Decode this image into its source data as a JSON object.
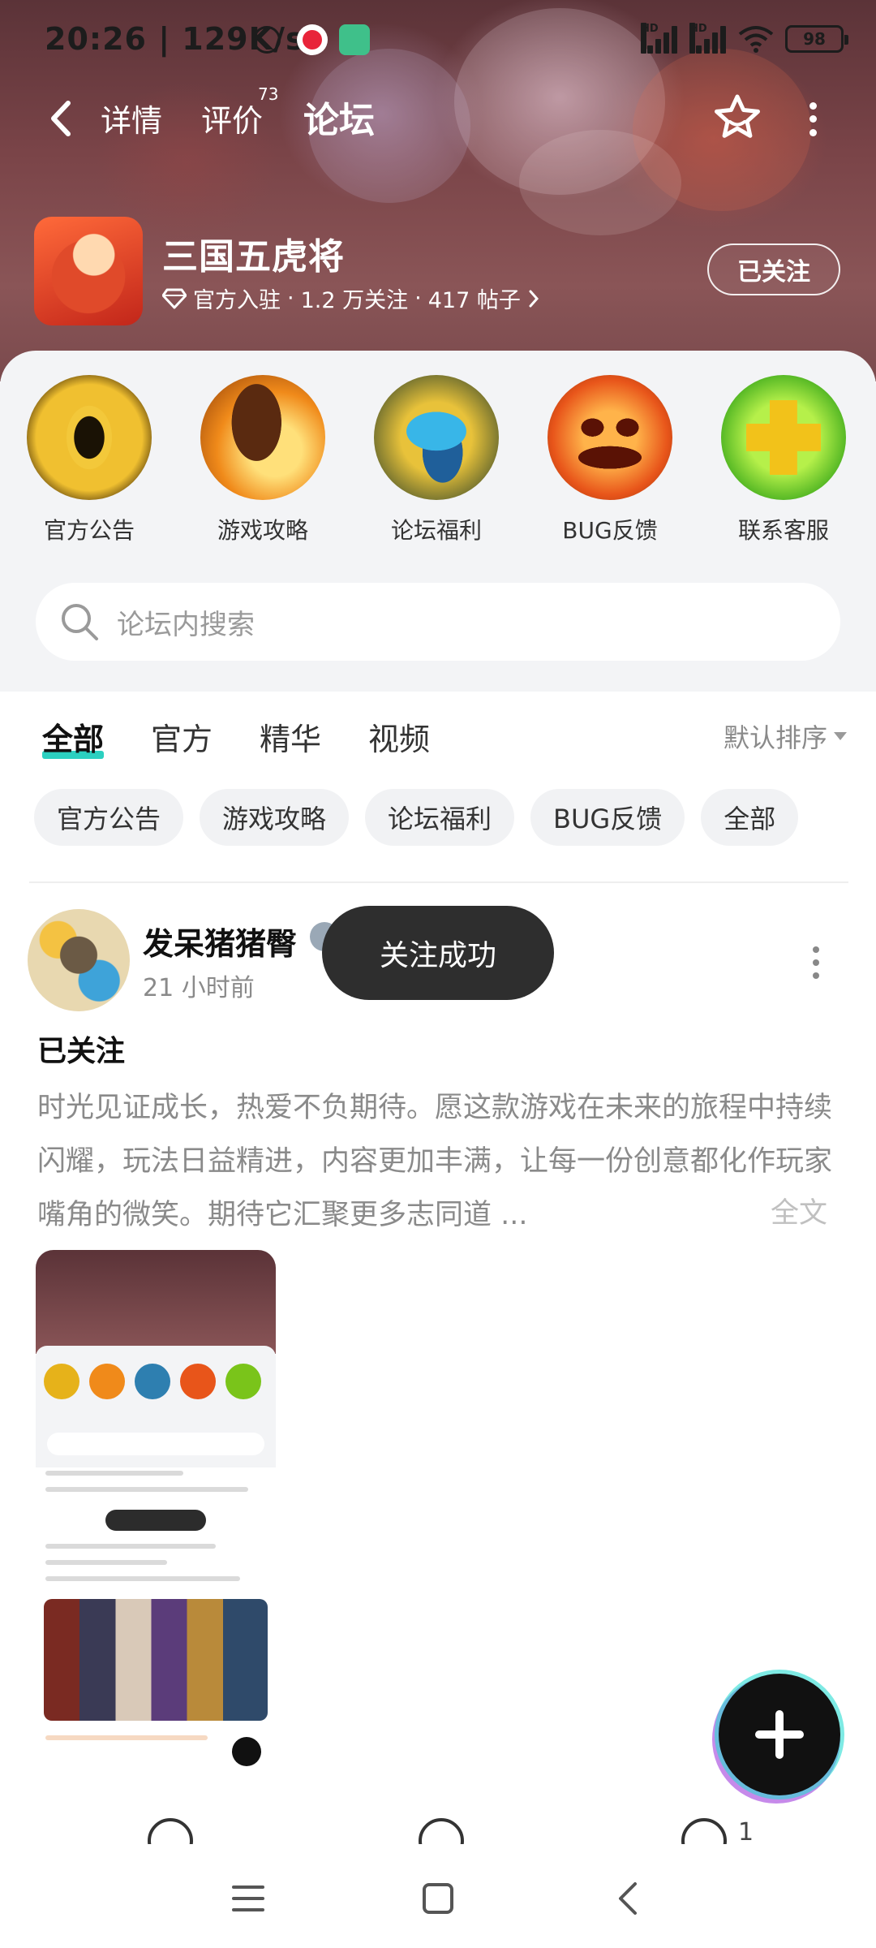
{
  "status_bar": {
    "time": "20:26 | 129K/s",
    "battery": "98"
  },
  "nav": {
    "tabs": [
      {
        "label": "详情"
      },
      {
        "label": "评价",
        "badge": "73"
      },
      {
        "label": "论坛",
        "active": true
      }
    ]
  },
  "game": {
    "title": "三国五虎将",
    "meta_official": "官方入驻",
    "meta_followers": "1.2 万关注",
    "meta_posts": "417 帖子",
    "follow_button": "已关注"
  },
  "categories": [
    {
      "label": "官方公告",
      "icon": "dragon-eye-icon",
      "color": "#e6b21a"
    },
    {
      "label": "游戏攻略",
      "icon": "scroll-icon",
      "color": "#f08a1a"
    },
    {
      "label": "论坛福利",
      "icon": "blue-ribbon-icon",
      "color": "#2e7fb0"
    },
    {
      "label": "BUG反馈",
      "icon": "pumpkin-icon",
      "color": "#e8551a"
    },
    {
      "label": "联系客服",
      "icon": "green-cross-icon",
      "color": "#7ac41a"
    }
  ],
  "search": {
    "placeholder": "论坛内搜索"
  },
  "filter_tabs": [
    {
      "label": "全部",
      "active": true
    },
    {
      "label": "官方"
    },
    {
      "label": "精华"
    },
    {
      "label": "视频"
    }
  ],
  "sort_label": "默认排序",
  "chips": [
    "官方公告",
    "游戏攻略",
    "论坛福利",
    "BUG反馈",
    "全部"
  ],
  "post": {
    "author": "发呆猪猪臀",
    "time": "21 小时前",
    "title": "已关注",
    "body": "时光见证成长，热爱不负期待。愿这款游戏在未来的旅程中持续闪耀，玩法日益精进，内容更加丰满，让每一份创意都化作玩家嘴角的微笑。期待它汇聚更多志同道 ...",
    "more": "全文",
    "like_count": "1"
  },
  "toast": "关注成功",
  "colors": {
    "accent": "#2bd0c0",
    "header": "#7a4448"
  }
}
